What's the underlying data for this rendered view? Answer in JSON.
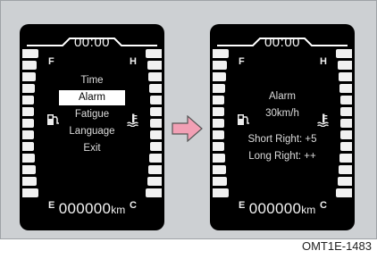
{
  "left_display": {
    "clock": "00:00",
    "gauge_left_top": "F",
    "gauge_left_bottom": "E",
    "gauge_right_top": "H",
    "gauge_right_bottom": "C",
    "menu": [
      "Time",
      "Alarm",
      "Fatigue",
      "Language",
      "Exit"
    ],
    "selected_item": "Alarm",
    "odometer_value": "000000",
    "odometer_unit": "km"
  },
  "right_display": {
    "clock": "00:00",
    "gauge_left_top": "F",
    "gauge_left_bottom": "E",
    "gauge_right_top": "H",
    "gauge_right_bottom": "C",
    "lines": [
      "Alarm",
      "30km/h",
      "Short Right: +5",
      "Long Right: ++"
    ],
    "odometer_value": "000000",
    "odometer_unit": "km"
  },
  "arrow_color": "#f2a0b5",
  "caption": "OMT1E-1483"
}
